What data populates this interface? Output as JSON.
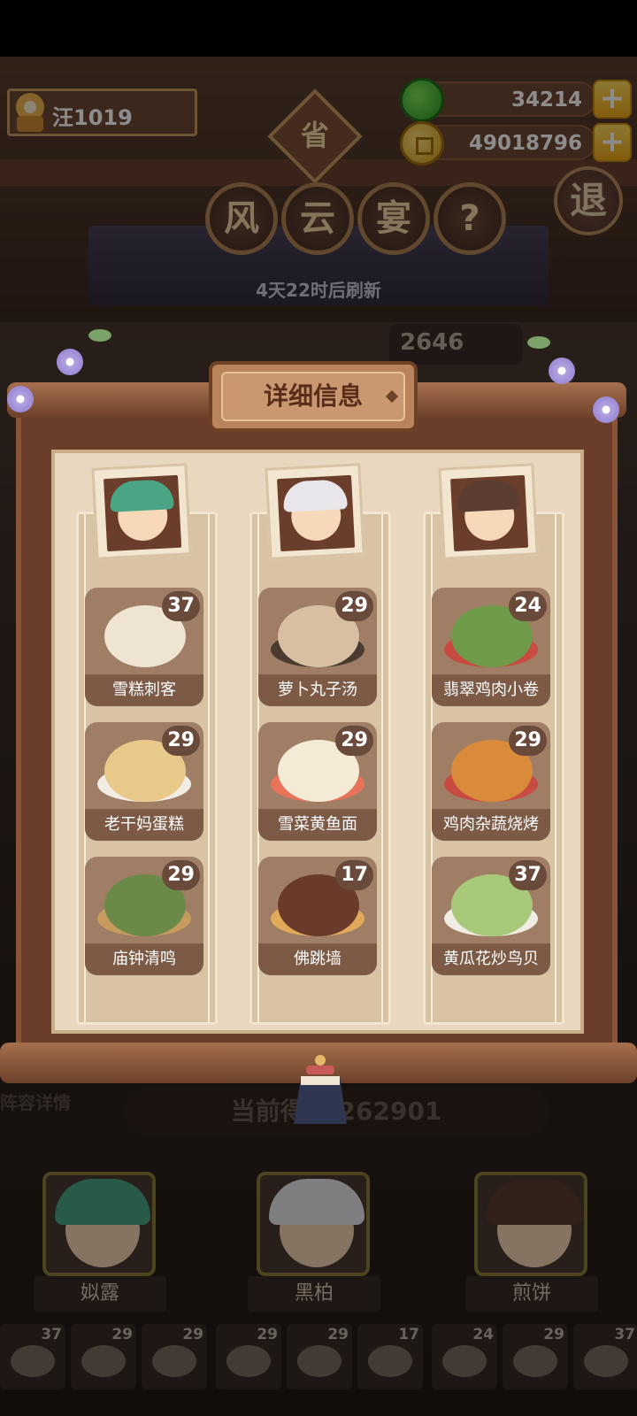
{
  "player": {
    "name": "汪1019"
  },
  "resources": {
    "jade": "34214",
    "coins": "49018796",
    "plus_symbol": "+"
  },
  "header": {
    "badge": "省",
    "title_chars": [
      "风",
      "云",
      "宴"
    ],
    "help_symbol": "?",
    "exit_label": "退",
    "refresh_text": "4天22时后刷新",
    "score_partial": "2646"
  },
  "modal": {
    "title": "详细信息",
    "columns": [
      {
        "character": "姒露",
        "dishes": [
          {
            "name": "雪糕刺客",
            "count": "37"
          },
          {
            "name": "老干妈蛋糕",
            "count": "29"
          },
          {
            "name": "庙钟清鸣",
            "count": "29"
          }
        ]
      },
      {
        "character": "黑柏",
        "dishes": [
          {
            "name": "萝卜丸子汤",
            "count": "29"
          },
          {
            "name": "雪菜黄鱼面",
            "count": "29"
          },
          {
            "name": "佛跳墙",
            "count": "17"
          }
        ]
      },
      {
        "character": "煎饼",
        "dishes": [
          {
            "name": "翡翠鸡肉小卷",
            "count": "24"
          },
          {
            "name": "鸡肉杂蔬烧烤",
            "count": "29"
          },
          {
            "name": "黄瓜花炒鸟贝",
            "count": "37"
          }
        ]
      }
    ]
  },
  "footer": {
    "left_label": "阵容详情",
    "current_score_label": "当前得分",
    "current_score_value": "262901",
    "characters": [
      "姒露",
      "黑柏",
      "煎饼"
    ],
    "mini_counts": [
      "37",
      "29",
      "29",
      "29",
      "29",
      "17",
      "24",
      "29",
      "37"
    ]
  },
  "colors": {
    "panel": "#6b3e2b",
    "parchment": "#e9d8bf",
    "dish_tile": "#a07e66",
    "dish_label": "#7c5a46",
    "accent_gold": "#f0a91a"
  }
}
